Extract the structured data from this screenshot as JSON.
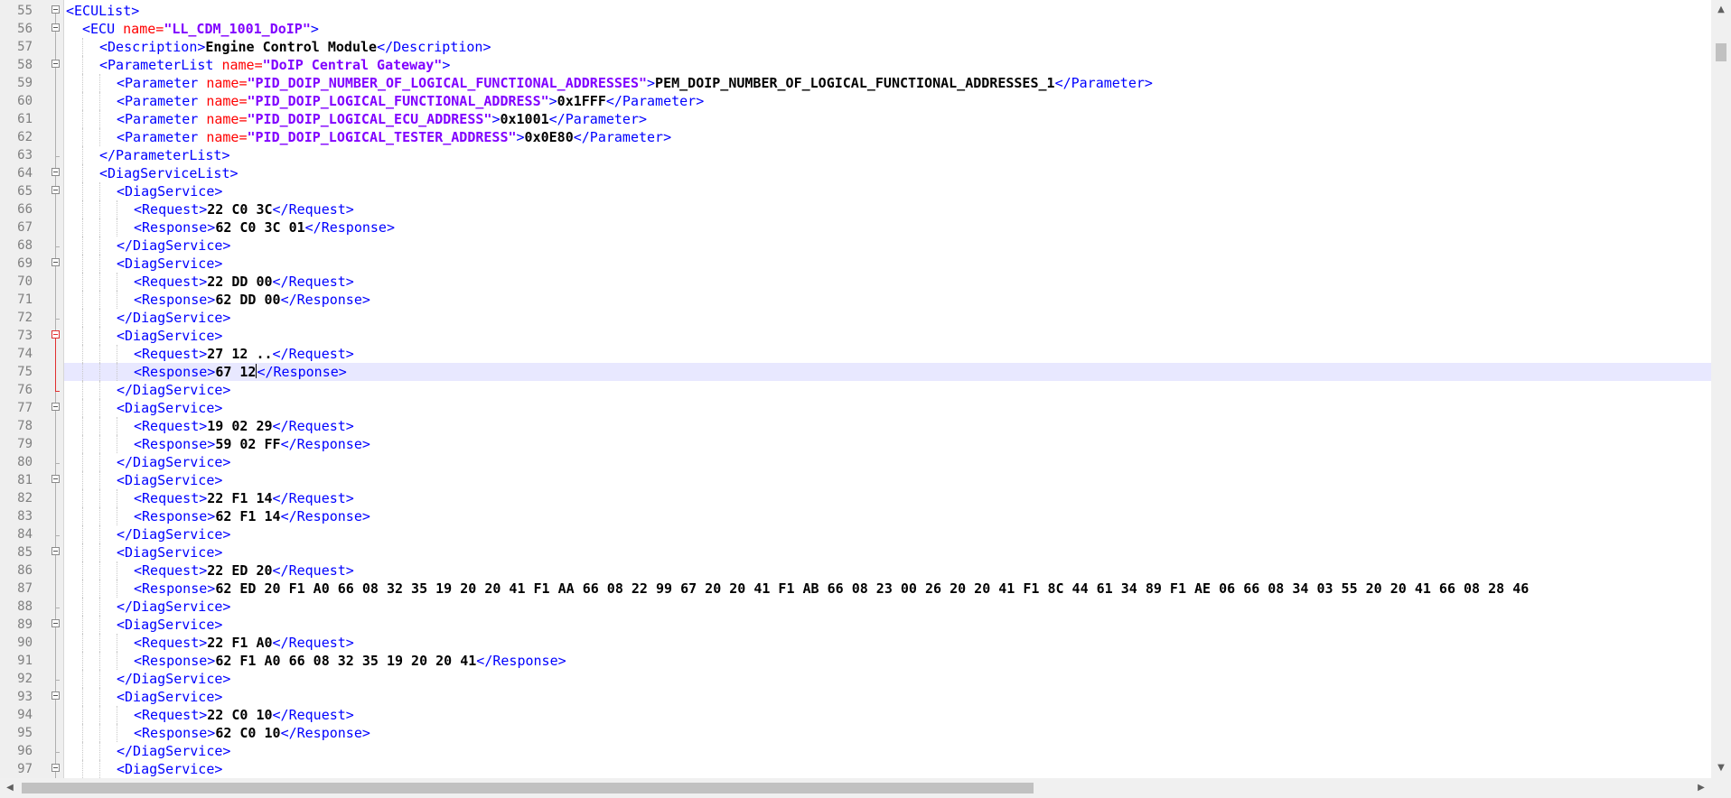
{
  "editor": {
    "language": "xml",
    "current_line": 75,
    "colors": {
      "tag": "#0000ff",
      "attribute": "#ff0000",
      "attribute_value": "#8000ff",
      "text": "#000000",
      "current_line_bg": "#e8e8ff",
      "gutter_bg": "#efefef"
    },
    "lines": [
      {
        "n": "55",
        "indent": 0,
        "tag": "<ECUList>"
      },
      {
        "n": "56",
        "indent": 1,
        "tag": "<ECU ",
        "attr": "name=",
        "val": "\"LL_CDM_1001_DoIP\"",
        "tag2": ">"
      },
      {
        "n": "57",
        "indent": 2,
        "tag": "<Description>",
        "text": "Engine Control Module",
        "tag2": "</Description>"
      },
      {
        "n": "58",
        "indent": 2,
        "tag": "<ParameterList ",
        "attr": "name=",
        "val": "\"DoIP Central Gateway\"",
        "tag2": ">"
      },
      {
        "n": "59",
        "indent": 3,
        "tag": "<Parameter ",
        "attr": "name=",
        "val": "\"PID_DOIP_NUMBER_OF_LOGICAL_FUNCTIONAL_ADDRESSES\"",
        "tag2": ">",
        "text": "PEM_DOIP_NUMBER_OF_LOGICAL_FUNCTIONAL_ADDRESSES_1",
        "tag3": "</Parameter>"
      },
      {
        "n": "60",
        "indent": 3,
        "tag": "<Parameter ",
        "attr": "name=",
        "val": "\"PID_DOIP_LOGICAL_FUNCTIONAL_ADDRESS\"",
        "tag2": ">",
        "text": "0x1FFF",
        "tag3": "</Parameter>"
      },
      {
        "n": "61",
        "indent": 3,
        "tag": "<Parameter ",
        "attr": "name=",
        "val": "\"PID_DOIP_LOGICAL_ECU_ADDRESS\"",
        "tag2": ">",
        "text": "0x1001",
        "tag3": "</Parameter>"
      },
      {
        "n": "62",
        "indent": 3,
        "tag": "<Parameter ",
        "attr": "name=",
        "val": "\"PID_DOIP_LOGICAL_TESTER_ADDRESS\"",
        "tag2": ">",
        "text": "0x0E80",
        "tag3": "</Parameter>"
      },
      {
        "n": "63",
        "indent": 2,
        "tag": "</ParameterList>"
      },
      {
        "n": "64",
        "indent": 2,
        "tag": "<DiagServiceList>"
      },
      {
        "n": "65",
        "indent": 3,
        "tag": "<DiagService>"
      },
      {
        "n": "66",
        "indent": 4,
        "tag": "<Request>",
        "text": "22 C0 3C",
        "tag2": "</Request>"
      },
      {
        "n": "67",
        "indent": 4,
        "tag": "<Response>",
        "text": "62 C0 3C 01",
        "tag2": "</Response>"
      },
      {
        "n": "68",
        "indent": 3,
        "tag": "</DiagService>"
      },
      {
        "n": "69",
        "indent": 3,
        "tag": "<DiagService>"
      },
      {
        "n": "70",
        "indent": 4,
        "tag": "<Request>",
        "text": "22 DD 00",
        "tag2": "</Request>"
      },
      {
        "n": "71",
        "indent": 4,
        "tag": "<Response>",
        "text": "62 DD 00",
        "tag2": "</Response>"
      },
      {
        "n": "72",
        "indent": 3,
        "tag": "</DiagService>"
      },
      {
        "n": "73",
        "indent": 3,
        "tag": "<DiagService>"
      },
      {
        "n": "74",
        "indent": 4,
        "tag": "<Request>",
        "text": "27 12 ..",
        "tag2": "</Request>"
      },
      {
        "n": "75",
        "indent": 4,
        "tag": "<Response>",
        "text": "67 12",
        "tag2": "</Response>"
      },
      {
        "n": "76",
        "indent": 3,
        "tag": "</DiagService>"
      },
      {
        "n": "77",
        "indent": 3,
        "tag": "<DiagService>"
      },
      {
        "n": "78",
        "indent": 4,
        "tag": "<Request>",
        "text": "19 02 29",
        "tag2": "</Request>"
      },
      {
        "n": "79",
        "indent": 4,
        "tag": "<Response>",
        "text": "59 02 FF",
        "tag2": "</Response>"
      },
      {
        "n": "80",
        "indent": 3,
        "tag": "</DiagService>"
      },
      {
        "n": "81",
        "indent": 3,
        "tag": "<DiagService>"
      },
      {
        "n": "82",
        "indent": 4,
        "tag": "<Request>",
        "text": "22 F1 14",
        "tag2": "</Request>"
      },
      {
        "n": "83",
        "indent": 4,
        "tag": "<Response>",
        "text": "62 F1 14",
        "tag2": "</Response>"
      },
      {
        "n": "84",
        "indent": 3,
        "tag": "</DiagService>"
      },
      {
        "n": "85",
        "indent": 3,
        "tag": "<DiagService>"
      },
      {
        "n": "86",
        "indent": 4,
        "tag": "<Request>",
        "text": "22 ED 20",
        "tag2": "</Request>"
      },
      {
        "n": "87",
        "indent": 4,
        "tag": "<Response>",
        "text": "62 ED 20 F1 A0 66 08 32 35 19 20 20 41 F1 AA 66 08 22 99 67 20 20 41 F1 AB 66 08 23 00 26 20 20 41 F1 8C 44 61 34 89 F1 AE 06 66 08 34 03 55 20 20 41 66 08 28 46"
      },
      {
        "n": "88",
        "indent": 3,
        "tag": "</DiagService>"
      },
      {
        "n": "89",
        "indent": 3,
        "tag": "<DiagService>"
      },
      {
        "n": "90",
        "indent": 4,
        "tag": "<Request>",
        "text": "22 F1 A0",
        "tag2": "</Request>"
      },
      {
        "n": "91",
        "indent": 4,
        "tag": "<Response>",
        "text": "62 F1 A0 66 08 32 35 19 20 20 41",
        "tag2": "</Response>"
      },
      {
        "n": "92",
        "indent": 3,
        "tag": "</DiagService>"
      },
      {
        "n": "93",
        "indent": 3,
        "tag": "<DiagService>"
      },
      {
        "n": "94",
        "indent": 4,
        "tag": "<Request>",
        "text": "22 C0 10",
        "tag2": "</Request>"
      },
      {
        "n": "95",
        "indent": 4,
        "tag": "<Response>",
        "text": "62 C0 10",
        "tag2": "</Response>"
      },
      {
        "n": "96",
        "indent": 3,
        "tag": "</DiagService>"
      },
      {
        "n": "97",
        "indent": 3,
        "tag": "<DiagService>"
      }
    ]
  },
  "scrollbars": {
    "up_icon": "▲",
    "down_icon": "▼",
    "left_icon": "◀",
    "right_icon": "▶",
    "vertical_position": 0.05,
    "horizontal_position": 0.0
  }
}
